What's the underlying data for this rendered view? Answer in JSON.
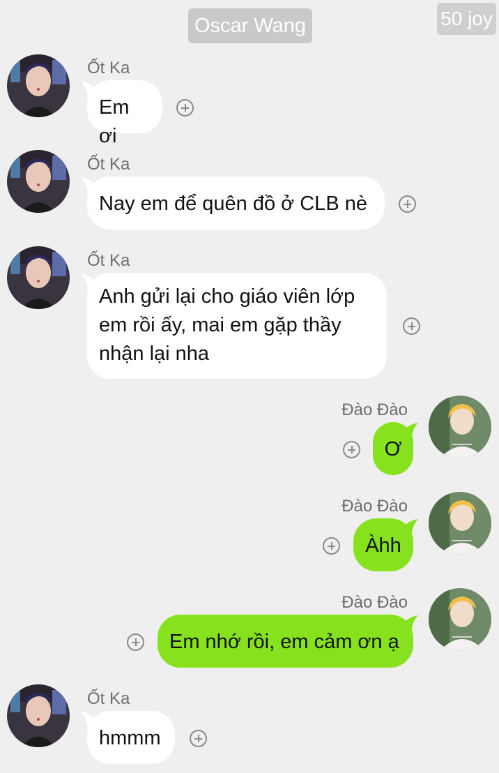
{
  "header": {
    "title": "Oscar Wang"
  },
  "watermark": "50 joy",
  "messages": [
    {
      "sender": "Ốt Ka",
      "text": "Em ơi",
      "side": "left"
    },
    {
      "sender": "Ốt Ka",
      "text": "Nay em để quên đồ ở CLB nè",
      "side": "left"
    },
    {
      "sender": "Ốt Ka",
      "lines": [
        "Anh gửi lại cho giáo viên lớp",
        "em rồi ấy, mai em gặp thầy",
        "nhận lại nha"
      ],
      "side": "left"
    },
    {
      "sender": "Đào Đào",
      "text": "Ơ",
      "side": "right"
    },
    {
      "sender": "Đào Đào",
      "text": "Àhh",
      "side": "right"
    },
    {
      "sender": "Đào Đào",
      "text": "Em nhớ rồi, em cảm ơn ạ",
      "side": "right"
    },
    {
      "sender": "Ốt Ka",
      "text": "hmmm",
      "side": "left"
    }
  ],
  "colors": {
    "background": "#efeff0",
    "incoming_bubble": "#ffffff",
    "outgoing_bubble": "#86e21c",
    "header_pill": "#c9c9ca"
  },
  "icons": {
    "reaction": "add-reaction-icon",
    "avatar_left": "avatar-otka",
    "avatar_right": "avatar-daodao"
  }
}
